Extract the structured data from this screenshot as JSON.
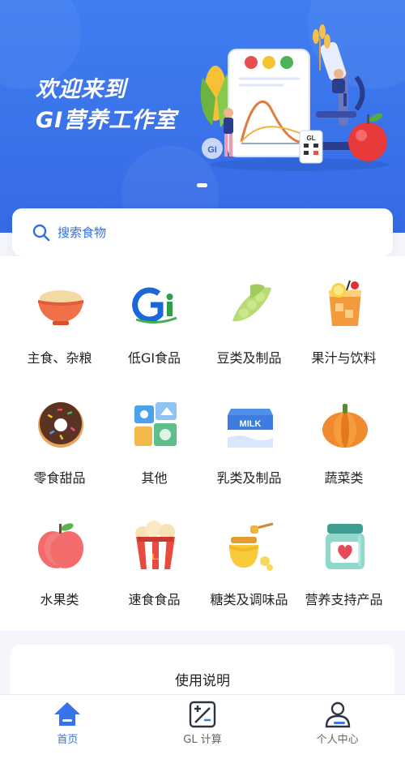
{
  "banner": {
    "line1": "欢迎来到",
    "line2": "GI营养工作室"
  },
  "search": {
    "placeholder": "搜索食物"
  },
  "categories": [
    {
      "label": "主食、杂粮",
      "icon": "rice-bowl-icon"
    },
    {
      "label": "低GI食品",
      "icon": "gi-logo-icon"
    },
    {
      "label": "豆类及制品",
      "icon": "soybean-icon"
    },
    {
      "label": "果汁与饮料",
      "icon": "juice-drink-icon"
    },
    {
      "label": "零食甜品",
      "icon": "donut-icon"
    },
    {
      "label": "其他",
      "icon": "misc-apps-icon"
    },
    {
      "label": "乳类及制品",
      "icon": "milk-carton-icon"
    },
    {
      "label": "蔬菜类",
      "icon": "pumpkin-icon"
    },
    {
      "label": "水果类",
      "icon": "apple-icon"
    },
    {
      "label": "速食食品",
      "icon": "popcorn-icon"
    },
    {
      "label": "糖类及调味品",
      "icon": "honey-jar-icon"
    },
    {
      "label": "营养支持产品",
      "icon": "nutrition-jar-icon"
    }
  ],
  "usage": {
    "title": "使用说明"
  },
  "tabbar": {
    "items": [
      {
        "label": "首页",
        "icon": "home-icon",
        "active": true
      },
      {
        "label": "GL 计算",
        "icon": "calculator-icon",
        "active": false
      },
      {
        "label": "个人中心",
        "icon": "user-icon",
        "active": false
      }
    ]
  },
  "colors": {
    "primary": "#3a72ea",
    "banner_top": "#3e7ef0",
    "background": "#f4f6fb"
  }
}
